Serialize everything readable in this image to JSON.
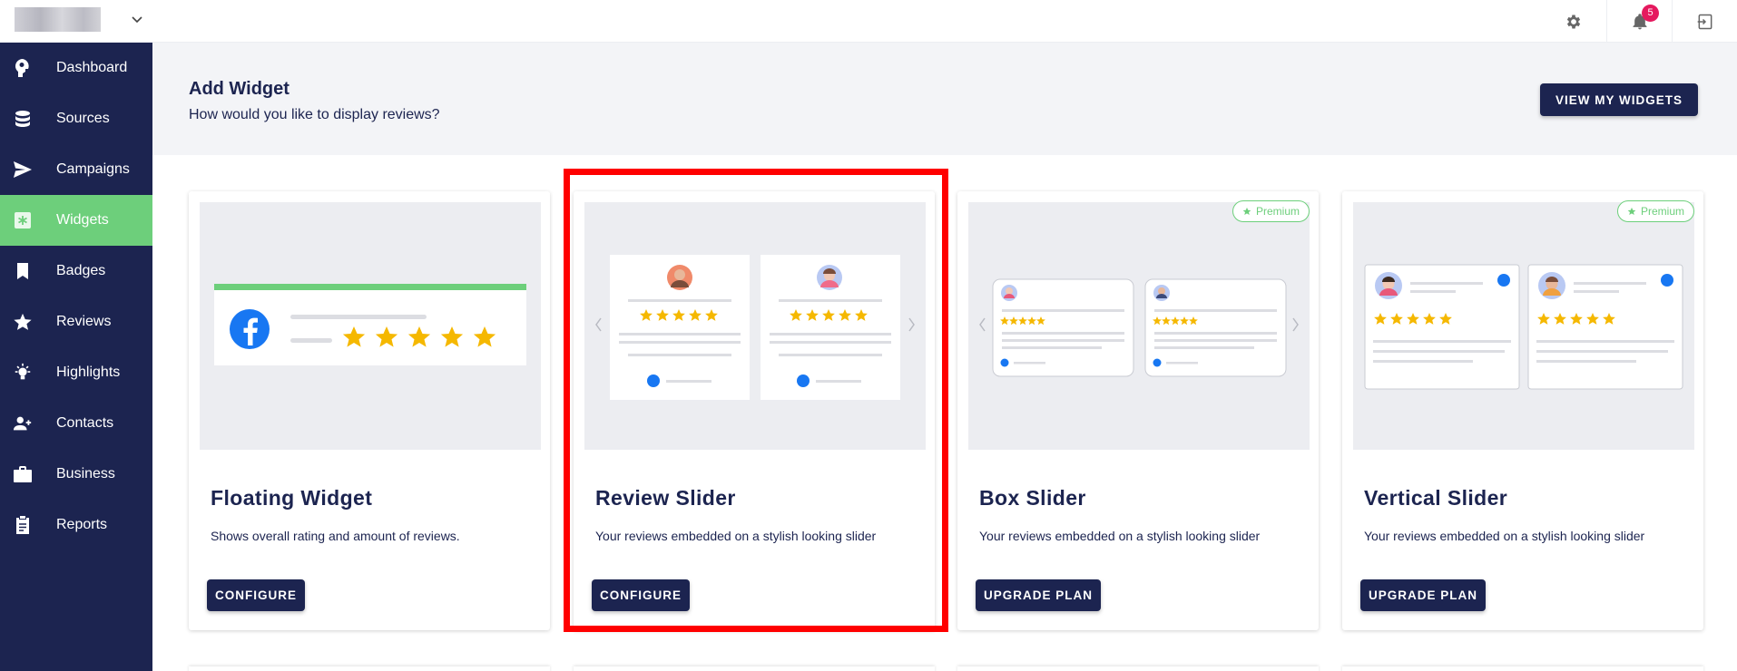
{
  "topbar": {
    "notifications_count": "5",
    "icons": [
      "chevron-down-icon",
      "gear-icon",
      "bell-icon",
      "logout-icon"
    ]
  },
  "sidebar": {
    "items": [
      {
        "label": "Dashboard",
        "icon": "dashboard-icon"
      },
      {
        "label": "Sources",
        "icon": "database-icon"
      },
      {
        "label": "Campaigns",
        "icon": "send-icon"
      },
      {
        "label": "Widgets",
        "icon": "widget-icon",
        "active": true
      },
      {
        "label": "Badges",
        "icon": "bookmark-icon"
      },
      {
        "label": "Reviews",
        "icon": "star-icon"
      },
      {
        "label": "Highlights",
        "icon": "lightbulb-icon"
      },
      {
        "label": "Contacts",
        "icon": "contacts-icon"
      },
      {
        "label": "Business",
        "icon": "briefcase-icon"
      },
      {
        "label": "Reports",
        "icon": "clipboard-icon"
      }
    ]
  },
  "header": {
    "title": "Add Widget",
    "subtitle": "How would you like to display reviews?",
    "view_button": "VIEW MY WIDGETS"
  },
  "cards": [
    {
      "title": "Floating Widget",
      "description": "Shows overall rating and amount of reviews.",
      "button": "CONFIGURE",
      "premium": false
    },
    {
      "title": "Review Slider",
      "description": "Your reviews embedded on a stylish looking slider",
      "button": "CONFIGURE",
      "premium": false,
      "highlighted": true
    },
    {
      "title": "Box Slider",
      "description": "Your reviews embedded on a stylish looking slider",
      "button": "UPGRADE PLAN",
      "premium": true,
      "premium_label": "Premium"
    },
    {
      "title": "Vertical Slider",
      "description": "Your reviews embedded on a stylish looking slider",
      "button": "UPGRADE PLAN",
      "premium": true,
      "premium_label": "Premium"
    }
  ],
  "colors": {
    "navy": "#1c2450",
    "green": "#6dcf7b",
    "star": "#f5b800",
    "facebook": "#1877f2",
    "highlight": "#ff0000",
    "badge": "#e5195e"
  }
}
